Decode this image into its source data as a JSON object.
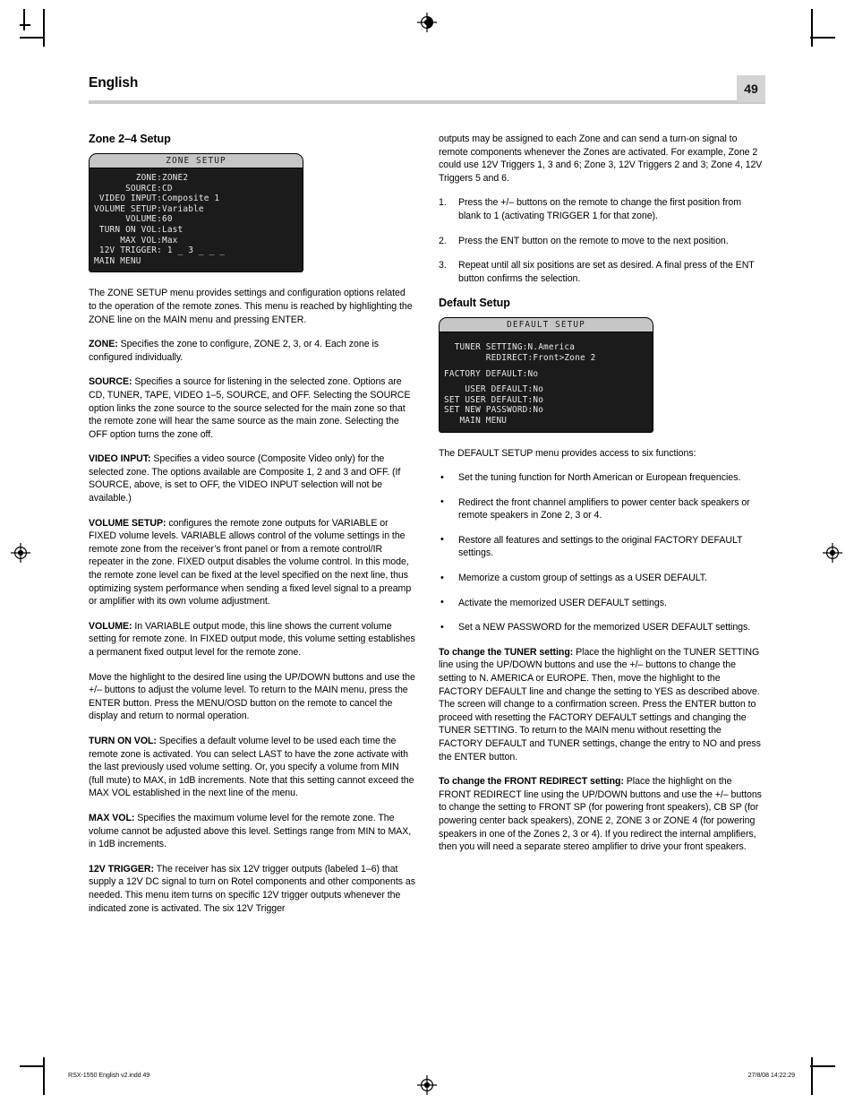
{
  "header": {
    "title": "English",
    "page_number": "49"
  },
  "left_column": {
    "section_title": "Zone 2–4 Setup",
    "osd": {
      "title": "ZONE SETUP",
      "lines": [
        "        ZONE:ZONE2",
        "      SOURCE:CD",
        " VIDEO INPUT:Composite 1",
        "VOLUME SETUP:Variable",
        "      VOLUME:60",
        " TURN ON VOL:Last",
        "     MAX VOL:Max",
        " 12V TRIGGER: 1 _ 3 _ _ _",
        "MAIN MENU"
      ]
    },
    "paragraphs": [
      {
        "lead": "",
        "text": "The ZONE SETUP menu provides settings and configuration options related to the operation of the remote zones. This menu is reached by highlighting the ZONE line on the MAIN menu and pressing ENTER."
      },
      {
        "lead": "ZONE:",
        "text": " Specifies the zone to configure, ZONE 2, 3, or 4. Each zone is configured individually."
      },
      {
        "lead": "SOURCE:",
        "text": " Specifies a source for listening in the selected zone. Options are CD, TUNER, TAPE, VIDEO 1–5, SOURCE, and OFF. Selecting the SOURCE option links the zone source to the source selected for the main zone so that the remote zone will hear the same source as the main zone. Selecting the OFF option turns the zone off."
      },
      {
        "lead": "VIDEO INPUT:",
        "text": " Specifies a video source (Composite Video only) for the selected zone. The options available are Composite 1, 2 and 3 and OFF. (If SOURCE, above, is set to OFF, the VIDEO INPUT selection will not be available.)"
      },
      {
        "lead": "VOLUME SETUP:",
        "text": " configures the remote zone outputs for VARIABLE or FIXED volume levels. VARIABLE allows control of the volume settings in the remote zone from the receiver’s front panel or from a remote control/IR repeater in the zone. FIXED output disables the volume control. In this mode, the remote zone level can be fixed at the level specified on the next line, thus optimizing system performance when sending a fixed level signal to a preamp or amplifier with its own volume adjustment."
      },
      {
        "lead": "VOLUME:",
        "text": " In VARIABLE output mode, this line shows the current volume setting for remote zone. In FIXED output mode, this volume setting establishes a permanent fixed output level for the remote zone."
      },
      {
        "lead": "",
        "text": "Move the highlight to the desired line using the UP/DOWN buttons and use the +/– buttons to adjust the volume level. To return to the MAIN menu, press the ENTER button. Press the MENU/OSD button on the remote to cancel the display and return to normal operation."
      },
      {
        "lead": "TURN ON VOL:",
        "text": " Specifies a default volume level to be used each time the remote zone is activated. You can select LAST to have the zone activate with the last previously used volume setting. Or, you specify a volume from MIN (full mute) to MAX, in 1dB increments. Note that this setting cannot exceed the MAX VOL established in the next line of the menu."
      },
      {
        "lead": "MAX VOL:",
        "text": " Specifies the maximum volume level for the remote zone. The volume cannot be adjusted above this level. Settings range from MIN to MAX, in 1dB increments."
      },
      {
        "lead": "12V TRIGGER:",
        "text": " The receiver has six 12V trigger outputs (labeled 1–6) that supply a 12V DC signal to turn on Rotel components and other components as needed. This menu item turns on specific 12V trigger outputs whenever the indicated zone is activated. The six 12V Trigger"
      }
    ]
  },
  "right_column": {
    "intro_paragraph": "outputs may be assigned to each Zone and can send a turn-on signal to remote components whenever the Zones are activated. For example, Zone 2 could use 12V Triggers 1, 3 and 6; Zone 3, 12V Triggers 2 and 3; Zone 4, 12V Triggers 5 and 6.",
    "steps": [
      {
        "num": "1.",
        "text": "Press the +/– buttons on the remote to change the first position from blank to 1 (activating TRIGGER 1 for that zone)."
      },
      {
        "num": "2.",
        "text": "Press the ENT button on the remote to move to the next position."
      },
      {
        "num": "3.",
        "text": "Repeat until all six positions are set as desired. A final press of the ENT button confirms the selection."
      }
    ],
    "section_title": "Default Setup",
    "osd": {
      "title": "DEFAULT SETUP",
      "lines_top": [
        "  TUNER SETTING:N.America",
        "        REDIRECT:Front>Zone 2"
      ],
      "lines_mid": [
        "FACTORY DEFAULT:No"
      ],
      "lines_bottom": [
        "    USER DEFAULT:No",
        "SET USER DEFAULT:No",
        "SET NEW PASSWORD:No",
        "   MAIN MENU"
      ]
    },
    "functions_intro": "The DEFAULT SETUP menu provides access to six functions:",
    "bullets": [
      "Set the tuning function for North American or European frequencies.",
      "Redirect the front channel amplifiers to power center back speakers or remote speakers in Zone 2, 3 or 4.",
      "Restore all features and settings to the original FACTORY DEFAULT settings.",
      "Memorize a custom group of settings as a USER DEFAULT.",
      "Activate the memorized USER DEFAULT settings.",
      "Set a NEW PASSWORD for the memorized USER DEFAULT settings."
    ],
    "paragraphs": [
      {
        "lead": "To change the TUNER setting:",
        "text": " Place the highlight on the TUNER SETTING line using the UP/DOWN buttons and use the +/– buttons to change the setting to N. AMERICA or EUROPE. Then, move the highlight to the FACTORY DEFAULT line and change the setting to YES as described above. The screen will change to a confirmation screen. Press the ENTER button to proceed with resetting the FACTORY DEFAULT settings and changing the TUNER SETTING. To return to the MAIN menu without resetting the FACTORY DEFAULT and TUNER settings, change the entry to NO and press the ENTER button."
      },
      {
        "lead": "To change the FRONT REDIRECT setting:",
        "text": " Place the highlight on the FRONT REDIRECT line using the UP/DOWN buttons and use the +/– buttons to change the setting to FRONT SP (for powering front speakers), CB SP (for powering center back speakers),  ZONE 2, ZONE 3 or ZONE 4 (for powering speakers in one of the Zones 2, 3 or 4). If you redirect the internal amplifiers, then you will need a separate stereo amplifier to drive your front speakers."
      }
    ]
  },
  "footer": {
    "left": "RSX-1550 English v2.indd   49",
    "right": "27/8/08   14:22:29"
  }
}
